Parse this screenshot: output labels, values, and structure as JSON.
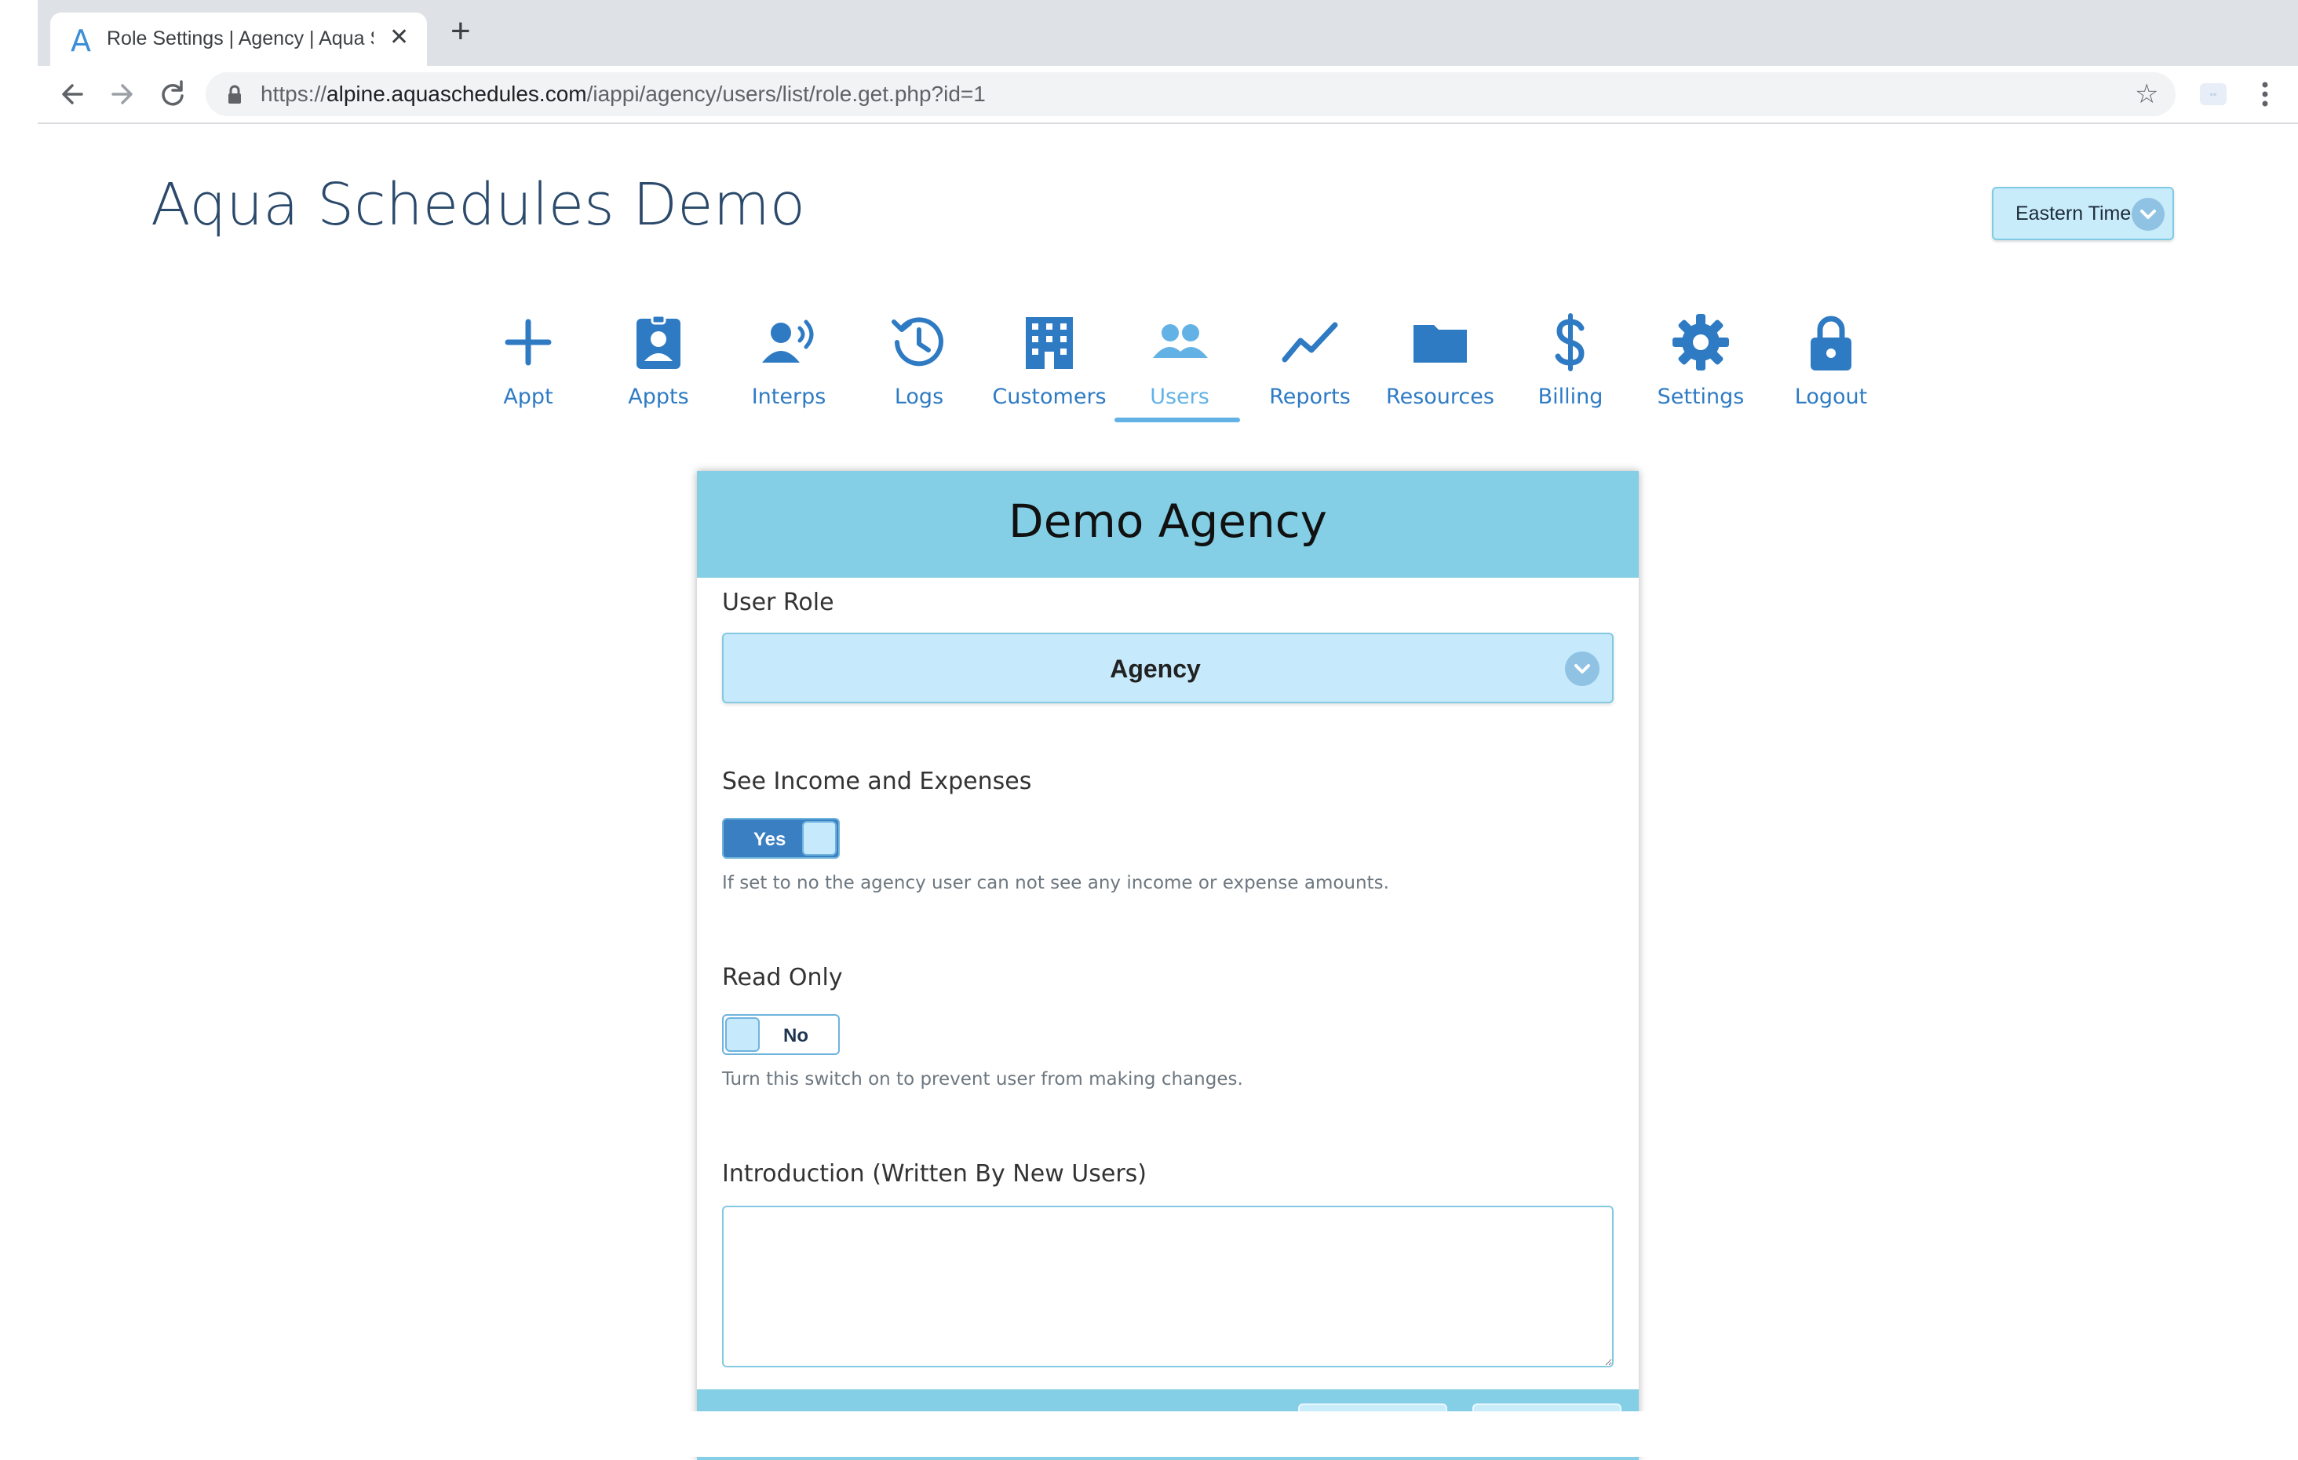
{
  "browser": {
    "tab_title": "Role Settings | Agency | Aqua Schedules",
    "tab_favicon": "A",
    "url_scheme": "https://",
    "url_host": "alpine.aquaschedules.com",
    "url_path": "/iappi/agency/users/list/role.get.php?id=1",
    "icons": [
      "back-arrow-icon",
      "forward-arrow-icon",
      "reload-icon",
      "lock-icon",
      "star-icon",
      "extension-icon",
      "menu-dots-icon",
      "close-icon",
      "plus-icon"
    ]
  },
  "header": {
    "app_title": "Aqua Schedules Demo",
    "timezone": "Eastern Time"
  },
  "nav": {
    "items": [
      {
        "label": "Appt",
        "icon": "plus-icon"
      },
      {
        "label": "Appts",
        "icon": "id-badge-icon"
      },
      {
        "label": "Interps",
        "icon": "user-speaking-icon"
      },
      {
        "label": "Logs",
        "icon": "history-icon"
      },
      {
        "label": "Customers",
        "icon": "building-icon"
      },
      {
        "label": "Users",
        "icon": "users-icon",
        "active": true
      },
      {
        "label": "Reports",
        "icon": "line-chart-icon"
      },
      {
        "label": "Resources",
        "icon": "folder-icon"
      },
      {
        "label": "Billing",
        "icon": "dollar-icon"
      },
      {
        "label": "Settings",
        "icon": "gear-icon"
      },
      {
        "label": "Logout",
        "icon": "lock-icon"
      }
    ],
    "colors": {
      "default": "#2e7bc4",
      "active": "#62b2e6"
    }
  },
  "card": {
    "title": "Demo Agency",
    "user_role_label": "User Role",
    "user_role_value": "Agency",
    "income_label": "See Income and Expenses",
    "income_toggle": "Yes",
    "income_help": "If set to no the agency user can not see any income or expense amounts.",
    "readonly_label": "Read Only",
    "readonly_toggle": "No",
    "readonly_help": "Turn this switch on to prevent user from making changes.",
    "intro_label": "Introduction (Written By New Users)",
    "intro_value": ""
  },
  "colors": {
    "header_bg": "#84cfe5",
    "select_bg": "#c6eafb",
    "toggle_on": "#3a7fc1",
    "title_text": "#2b4a6b"
  }
}
